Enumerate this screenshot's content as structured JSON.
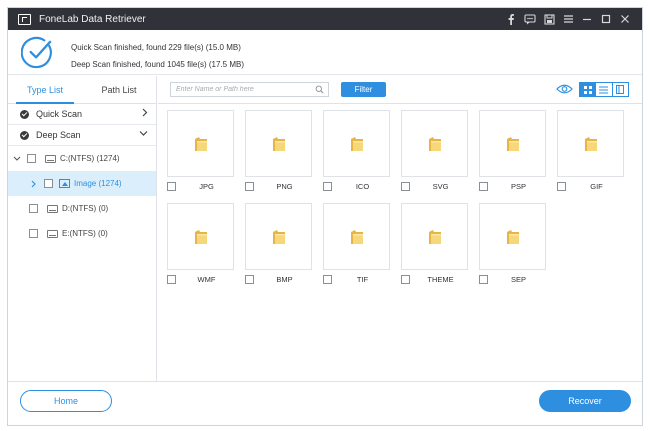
{
  "app": {
    "title": "FoneLab Data Retriever"
  },
  "title_controls": [
    "facebook-icon",
    "chat-icon",
    "save-icon",
    "menu-icon",
    "minimize-icon",
    "maximize-icon",
    "close-icon"
  ],
  "status": {
    "quick": "Quick Scan finished, found 229 file(s) (15.0 MB)",
    "deep": "Deep Scan finished, found 1045 file(s) (17.5 MB)"
  },
  "sidebar": {
    "tabs": [
      {
        "label": "Type List",
        "active": true
      },
      {
        "label": "Path List",
        "active": false
      }
    ],
    "scans": [
      {
        "label": "Quick Scan"
      },
      {
        "label": "Deep Scan"
      }
    ],
    "tree": [
      {
        "label": "C:(NTFS) (1274)"
      },
      {
        "label": "Image (1274)"
      },
      {
        "label": "D:(NTFS) (0)"
      },
      {
        "label": "E:(NTFS) (0)"
      }
    ]
  },
  "toolbar": {
    "search_placeholder": "Enter Name or Path here",
    "filter_label": "Filter",
    "view_mode": "grid"
  },
  "files": [
    {
      "label": "JPG"
    },
    {
      "label": "PNG"
    },
    {
      "label": "ICO"
    },
    {
      "label": "SVG"
    },
    {
      "label": "PSP"
    },
    {
      "label": "GIF"
    },
    {
      "label": "WMF"
    },
    {
      "label": "BMP"
    },
    {
      "label": "TIF"
    },
    {
      "label": "THEME"
    },
    {
      "label": "SEP"
    }
  ],
  "footer": {
    "home_label": "Home",
    "recover_label": "Recover"
  },
  "colors": {
    "accent": "#2e8fe1",
    "titlebar": "#2f3238",
    "folder": "#f0c35a"
  }
}
